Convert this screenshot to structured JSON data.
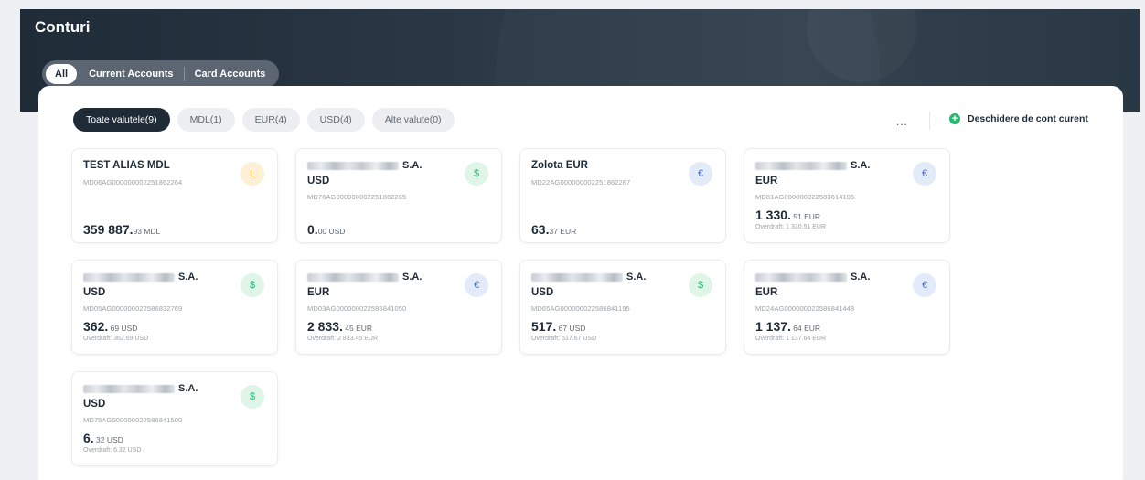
{
  "header": {
    "title": "Conturi",
    "tabs": [
      {
        "label": "All",
        "active": true
      },
      {
        "label": "Current Accounts",
        "active": false
      },
      {
        "label": "Card Accounts",
        "active": false
      }
    ]
  },
  "filters": {
    "chips": [
      {
        "label": "Toate valutele(9)",
        "active": true
      },
      {
        "label": "MDL(1)",
        "active": false
      },
      {
        "label": "EUR(4)",
        "active": false
      },
      {
        "label": "USD(4)",
        "active": false
      },
      {
        "label": "Alte valute(0)",
        "active": false
      }
    ],
    "more_label": "...",
    "open_account_label": "Deschidere de cont curent"
  },
  "colors": {
    "header_bg": "#2b3845",
    "accent_dark": "#1f2b37",
    "usd_badge": "#2bb673",
    "eur_badge": "#4a6fd6",
    "mdl_badge": "#e0a431",
    "plus_icon": "#2bb673"
  },
  "badges": {
    "MDL": {
      "symbol": "L",
      "bg": "#fdf0d5",
      "fg": "#e0a431",
      "icon": "leu-icon"
    },
    "USD": {
      "symbol": "$",
      "bg": "#dff5e8",
      "fg": "#2bb673",
      "icon": "dollar-icon"
    },
    "EUR": {
      "symbol": "€",
      "bg": "#e4ebf8",
      "fg": "#4a6fd6",
      "icon": "euro-icon"
    }
  },
  "accounts": [
    {
      "name": "TEST ALIAS MDL",
      "currency": "MDL",
      "iban": "MD06AG000000002251862264",
      "amount_int": "359 887.",
      "amount_dec": "93 MDL"
    },
    {
      "name_suffix": "S.A.",
      "name_blurred": true,
      "currency": "USD",
      "iban": "MD76AG000000002251862265",
      "amount_int": "0.",
      "amount_dec": "00 USD"
    },
    {
      "name": "Zolota EUR",
      "currency": "EUR",
      "iban": "MD22AG000000002251862267",
      "amount_int": "63.",
      "amount_dec": "37 EUR"
    },
    {
      "name_suffix": "S.A.",
      "name_blurred": true,
      "currency": "EUR",
      "iban": "MD81AG000000022583614105",
      "amount_int": "1 330.",
      "amount_dec": " 51 EUR",
      "overdraft": "Overdraft: 1 330.51 EUR"
    },
    {
      "name_suffix": "S.A.",
      "name_blurred": true,
      "currency": "USD",
      "iban": "MD05AG000000022586832769",
      "amount_int": "362.",
      "amount_dec": " 69 USD",
      "overdraft": "Overdraft: 362.69 USD"
    },
    {
      "name_suffix": "S.A.",
      "name_blurred": true,
      "currency": "EUR",
      "iban": "MD03AG000000022586841050",
      "amount_int": "2 833.",
      "amount_dec": " 45 EUR",
      "overdraft": "Overdraft: 2 833.45 EUR"
    },
    {
      "name_suffix": "S.A.",
      "name_blurred": true,
      "currency": "USD",
      "iban": "MD65AG000000022586841195",
      "amount_int": "517.",
      "amount_dec": " 67 USD",
      "overdraft": "Overdraft: 517.67 USD"
    },
    {
      "name_suffix": "S.A.",
      "name_blurred": true,
      "currency": "EUR",
      "iban": "MD24AG000000022586841448",
      "amount_int": "1 137.",
      "amount_dec": " 64 EUR",
      "overdraft": "Overdraft: 1 137.64 EUR"
    },
    {
      "name_suffix": "S.A.",
      "name_blurred": true,
      "currency": "USD",
      "iban": "MD75AG000000022586841500",
      "amount_int": "6.",
      "amount_dec": " 32 USD",
      "overdraft": "Overdraft: 6.32 USD"
    }
  ]
}
